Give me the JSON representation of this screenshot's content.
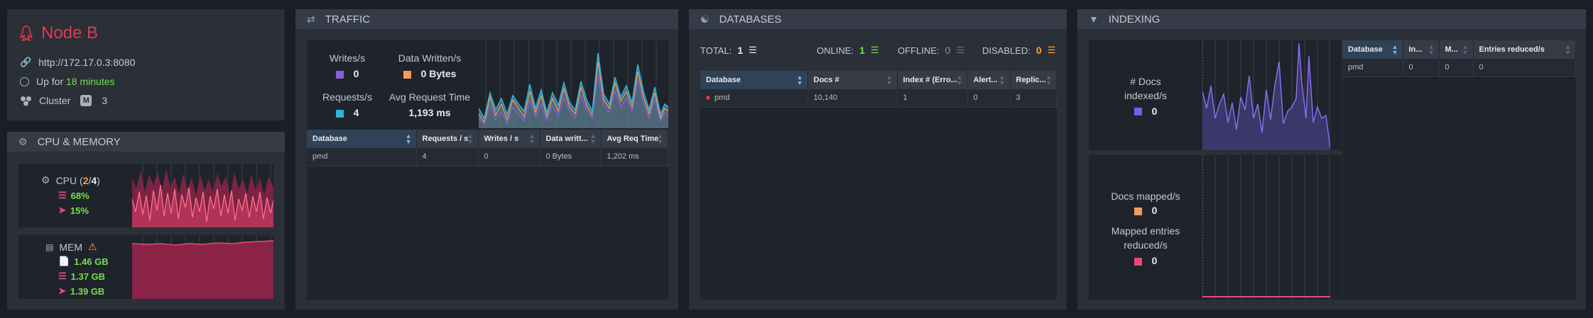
{
  "node": {
    "name": "Node B",
    "url": "http://172.17.0.3:8080",
    "uptime_prefix": "Up for",
    "uptime_value": "18 minutes",
    "cluster_label": "Cluster",
    "cluster_badge": "M",
    "cluster_count": "3"
  },
  "cpu_memory": {
    "title": "CPU & MEMORY",
    "cpu_label": "CPU",
    "cpu_cores_open": "(",
    "cpu_cores_used": "2",
    "cpu_cores_sep": "/",
    "cpu_cores_total": "4",
    "cpu_cores_close": ")",
    "cpu_machine": "68%",
    "cpu_process": "15%",
    "mem_label": "MEM",
    "mem_values": [
      "1.46 GB",
      "1.37 GB",
      "1.39 GB"
    ]
  },
  "traffic": {
    "title": "TRAFFIC",
    "writes_label": "Writes/s",
    "writes_value": "0",
    "data_written_label": "Data Written/s",
    "data_written_value": "0 Bytes",
    "requests_label": "Requests/s",
    "requests_value": "4",
    "avg_req_label": "Avg Request Time",
    "avg_req_value": "1,193 ms",
    "colors": {
      "writes": "#8a5fd8",
      "data": "#f29b5c",
      "requests": "#2bb3d8"
    },
    "table": {
      "columns": [
        "Database",
        "Requests / s",
        "Writes / s",
        "Data writt...",
        "Avg Req Time"
      ],
      "rows": [
        [
          "pmd",
          "4",
          "0",
          "0 Bytes",
          "1,202 ms"
        ]
      ]
    }
  },
  "databases": {
    "title": "DATABASES",
    "total_label": "TOTAL:",
    "total_value": "1",
    "online_label": "ONLINE:",
    "online_value": "1",
    "offline_label": "OFFLINE:",
    "offline_value": "0",
    "disabled_label": "DISABLED:",
    "disabled_value": "0",
    "table": {
      "columns": [
        "Database",
        "Docs #",
        "Index # (Erro...",
        "Alert...",
        "Replic..."
      ],
      "rows": [
        [
          "pmd",
          "10,140",
          "1",
          "0",
          "3"
        ]
      ]
    }
  },
  "indexing": {
    "title": "INDEXING",
    "docs_indexed_label": "# Docs indexed/s",
    "docs_indexed_value": "0",
    "docs_mapped_label": "Docs mapped/s",
    "docs_mapped_value": "0",
    "mapped_reduced_label": "Mapped entries reduced/s",
    "mapped_reduced_value": "0",
    "colors": {
      "indexed": "#7b5ce6",
      "mapped": "#f29b5c",
      "reduced": "#e84a78"
    },
    "table": {
      "columns": [
        "Database",
        "In...",
        "M...",
        "Entries reduced/s"
      ],
      "rows": [
        [
          "pmd",
          "0",
          "0",
          "0"
        ]
      ]
    }
  }
}
